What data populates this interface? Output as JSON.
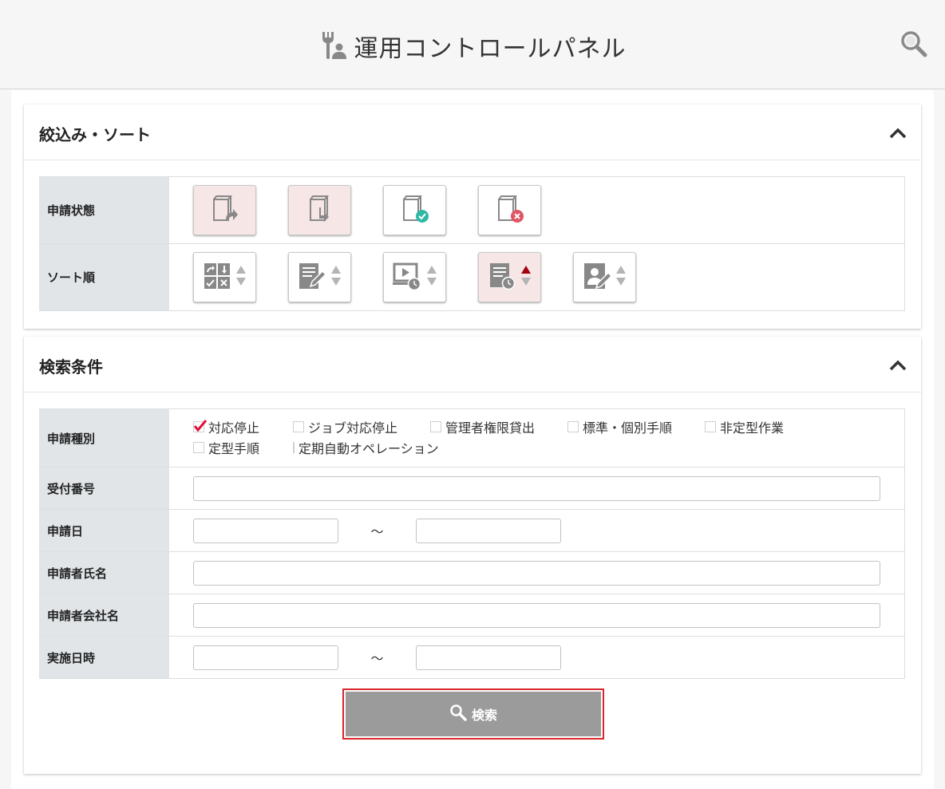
{
  "header": {
    "title": "運用コントロールパネル"
  },
  "filter_panel": {
    "title": "絞込み・ソート",
    "status_label": "申請状態",
    "status_buttons": [
      {
        "icon": "doc-forward-icon",
        "active": true
      },
      {
        "icon": "doc-return-icon",
        "active": true
      },
      {
        "icon": "doc-approved-icon",
        "active": false
      },
      {
        "icon": "doc-rejected-icon",
        "active": false
      }
    ],
    "sort_label": "ソート順",
    "sort_buttons": [
      {
        "icon": "workflow-status-icon",
        "active": false
      },
      {
        "icon": "doc-edit-icon",
        "active": false
      },
      {
        "icon": "screen-clock-icon",
        "active": false
      },
      {
        "icon": "doc-clock-icon",
        "active": true,
        "direction": "asc"
      },
      {
        "icon": "user-edit-icon",
        "active": false
      }
    ]
  },
  "search_panel": {
    "title": "検索条件",
    "type_label": "申請種別",
    "types": [
      {
        "label": "対応停止",
        "checked": true
      },
      {
        "label": "ジョブ対応停止",
        "checked": false
      },
      {
        "label": "管理者権限貸出",
        "checked": false
      },
      {
        "label": "標準・個別手順",
        "checked": false
      },
      {
        "label": "非定型作業",
        "checked": false
      },
      {
        "label": "定型手順",
        "checked": false
      },
      {
        "label": "定期自動オペレーション",
        "checked": false
      }
    ],
    "receipt_label": "受付番号",
    "receipt_value": "",
    "apply_date_label": "申請日",
    "apply_date_from": "",
    "apply_date_to": "",
    "range_sep": "～",
    "applicant_label": "申請者氏名",
    "applicant_value": "",
    "company_label": "申請者会社名",
    "company_value": "",
    "exec_date_label": "実施日時",
    "exec_date_from": "",
    "exec_date_to": "",
    "search_button": "検索"
  },
  "colors": {
    "accent_red": "#d9262b",
    "sort_active_arrow": "#a4000f",
    "check_red": "#e0103a",
    "active_button_bg": "#f6e6e6",
    "label_bg": "#e1e5e8",
    "search_button_bg": "#9b9b9b"
  }
}
